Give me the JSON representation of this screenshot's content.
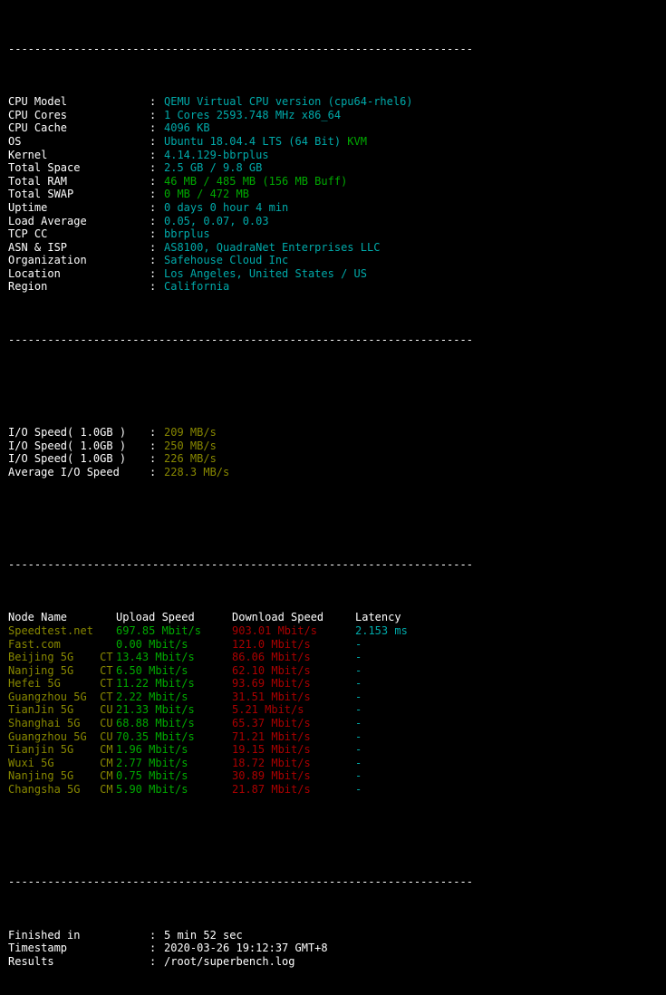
{
  "terminal": {
    "divider": "-----------------------------------------------------------------------",
    "colors": {
      "background": "#000000",
      "white": "#ffffff",
      "cyan": "#00aaaa",
      "green": "#00aa00",
      "yellow": "#888800",
      "red": "#aa0000"
    }
  },
  "system_info": {
    "rows": [
      {
        "label": "CPU Model",
        "sep": ":",
        "value": "QEMU Virtual CPU version (cpu64-rhel6)",
        "color": "cyan"
      },
      {
        "label": "CPU Cores",
        "sep": ":",
        "value": "1 Cores 2593.748 MHz x86_64",
        "color": "cyan"
      },
      {
        "label": "CPU Cache",
        "sep": ":",
        "value": "4096 KB",
        "color": "cyan"
      },
      {
        "label": "OS",
        "sep": ":",
        "value": "Ubuntu 18.04.4 LTS (64 Bit)",
        "color": "cyan",
        "suffix": " KVM",
        "suffix_color": "green"
      },
      {
        "label": "Kernel",
        "sep": ":",
        "value": "4.14.129-bbrplus",
        "color": "cyan"
      },
      {
        "label": "Total Space",
        "sep": ":",
        "value": "2.5 GB / 9.8 GB",
        "color": "cyan"
      },
      {
        "label": "Total RAM",
        "sep": ":",
        "value": "46 MB / 485 MB (156 MB Buff)",
        "color": "green"
      },
      {
        "label": "Total SWAP",
        "sep": ":",
        "value": "0 MB / 472 MB",
        "color": "green"
      },
      {
        "label": "Uptime",
        "sep": ":",
        "value": "0 days 0 hour 4 min",
        "color": "cyan"
      },
      {
        "label": "Load Average",
        "sep": ":",
        "value": "0.05, 0.07, 0.03",
        "color": "cyan"
      },
      {
        "label": "TCP CC",
        "sep": ":",
        "value": "bbrplus",
        "color": "cyan"
      },
      {
        "label": "ASN & ISP",
        "sep": ":",
        "value": "AS8100, QuadraNet Enterprises LLC",
        "color": "cyan"
      },
      {
        "label": "Organization",
        "sep": ":",
        "value": "Safehouse Cloud Inc",
        "color": "cyan"
      },
      {
        "label": "Location",
        "sep": ":",
        "value": "Los Angeles, United States / US",
        "color": "cyan"
      },
      {
        "label": "Region",
        "sep": ":",
        "value": "California",
        "color": "cyan"
      }
    ]
  },
  "io_speed": {
    "rows": [
      {
        "label": "I/O Speed( 1.0GB )",
        "sep": ":",
        "value": "209 MB/s",
        "color": "yellow"
      },
      {
        "label": "I/O Speed( 1.0GB )",
        "sep": ":",
        "value": "250 MB/s",
        "color": "yellow"
      },
      {
        "label": "I/O Speed( 1.0GB )",
        "sep": ":",
        "value": "226 MB/s",
        "color": "yellow"
      },
      {
        "label": "Average I/O Speed",
        "sep": ":",
        "value": "228.3 MB/s",
        "color": "yellow"
      }
    ]
  },
  "speedtest": {
    "headers": {
      "node": "Node Name",
      "upload": "Upload Speed",
      "download": "Download Speed",
      "latency": "Latency"
    },
    "rows": [
      {
        "node": "Speedtest.net",
        "isp": "",
        "upload": "697.85 Mbit/s",
        "download": "903.01 Mbit/s",
        "latency": "2.153 ms"
      },
      {
        "node": "Fast.com",
        "isp": "",
        "upload": "0.00 Mbit/s",
        "download": "121.0 Mbit/s",
        "latency": "-"
      },
      {
        "node": "Beijing 5G",
        "isp": "CT",
        "upload": "13.43 Mbit/s",
        "download": "86.06 Mbit/s",
        "latency": "-"
      },
      {
        "node": "Nanjing 5G",
        "isp": "CT",
        "upload": "6.50 Mbit/s",
        "download": "62.10 Mbit/s",
        "latency": "-"
      },
      {
        "node": "Hefei 5G",
        "isp": "CT",
        "upload": "11.22 Mbit/s",
        "download": "93.69 Mbit/s",
        "latency": "-"
      },
      {
        "node": "Guangzhou 5G",
        "isp": "CT",
        "upload": "2.22 Mbit/s",
        "download": "31.51 Mbit/s",
        "latency": "-"
      },
      {
        "node": "TianJin 5G",
        "isp": "CU",
        "upload": "21.33 Mbit/s",
        "download": "5.21 Mbit/s",
        "latency": "-"
      },
      {
        "node": "Shanghai 5G",
        "isp": "CU",
        "upload": "68.88 Mbit/s",
        "download": "65.37 Mbit/s",
        "latency": "-"
      },
      {
        "node": "Guangzhou 5G",
        "isp": "CU",
        "upload": "70.35 Mbit/s",
        "download": "71.21 Mbit/s",
        "latency": "-"
      },
      {
        "node": "Tianjin 5G",
        "isp": "CM",
        "upload": "1.96 Mbit/s",
        "download": "19.15 Mbit/s",
        "latency": "-"
      },
      {
        "node": "Wuxi 5G",
        "isp": "CM",
        "upload": "2.77 Mbit/s",
        "download": "18.72 Mbit/s",
        "latency": "-"
      },
      {
        "node": "Nanjing 5G",
        "isp": "CM",
        "upload": "0.75 Mbit/s",
        "download": "30.89 Mbit/s",
        "latency": "-"
      },
      {
        "node": "Changsha 5G",
        "isp": "CM",
        "upload": "5.90 Mbit/s",
        "download": "21.87 Mbit/s",
        "latency": "-"
      }
    ]
  },
  "summary": {
    "rows": [
      {
        "label": "Finished in",
        "sep": ":",
        "value": "5 min 52 sec"
      },
      {
        "label": "Timestamp",
        "sep": ":",
        "value": "2020-03-26 19:12:37 GMT+8"
      },
      {
        "label": "Results",
        "sep": ":",
        "value": "/root/superbench.log"
      }
    ]
  }
}
